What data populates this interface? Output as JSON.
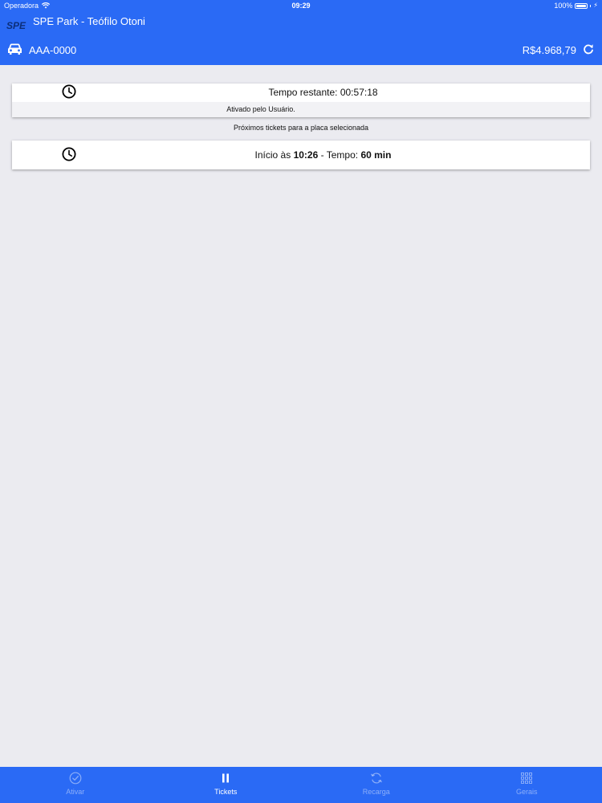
{
  "status_bar": {
    "carrier": "Operadora",
    "time": "09:29",
    "battery": "100%"
  },
  "header": {
    "logo_text": "SPE",
    "title": "SPE Park - Teófilo Otoni",
    "plate": "AAA-0000",
    "balance": "R$4.968,79"
  },
  "active_ticket": {
    "remaining": "Tempo restante: 00:57:18",
    "activated_by": "Ativado pelo Usuário."
  },
  "next_section": {
    "caption": "Próximos tickets para a placa selecionada"
  },
  "next_ticket": {
    "start_prefix": "Início às",
    "start_time": "10:26",
    "duration_prefix": "- Tempo:",
    "duration": "60 min"
  },
  "tabs": [
    {
      "label": "Ativar",
      "icon": "check-circle-icon",
      "active": false
    },
    {
      "label": "Tickets",
      "icon": "pause-icon",
      "active": true
    },
    {
      "label": "Recarga",
      "icon": "recharge-icon",
      "active": false
    },
    {
      "label": "Gerais",
      "icon": "grid-icon",
      "active": false
    }
  ],
  "colors": {
    "brand_blue": "#2a6af5",
    "background": "#ebebf0"
  }
}
